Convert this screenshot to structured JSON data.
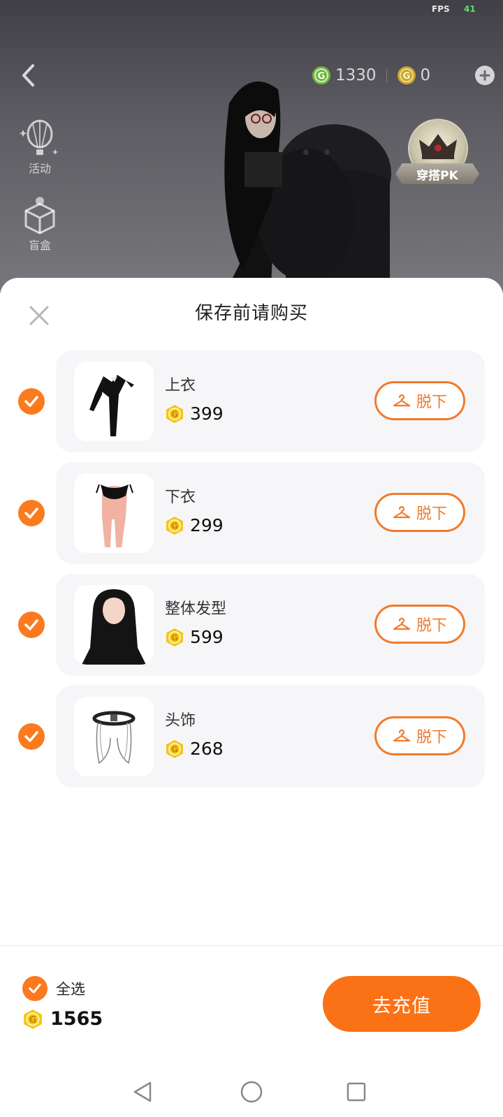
{
  "status": {
    "fps_label": "FPS",
    "fps_value": "41"
  },
  "top_bar": {
    "green_currency": "1330",
    "gold_currency": "0"
  },
  "side_menu": [
    {
      "label": "活动",
      "icon": "hot-air-balloon-icon"
    },
    {
      "label": "盲盒",
      "icon": "gift-box-icon"
    }
  ],
  "pk_badge": {
    "label": "穿搭PK"
  },
  "sheet": {
    "title": "保存前请购买",
    "items": [
      {
        "name": "上衣",
        "price": "399",
        "action": "脱下",
        "checked": true
      },
      {
        "name": "下衣",
        "price": "299",
        "action": "脱下",
        "checked": true
      },
      {
        "name": "整体发型",
        "price": "599",
        "action": "脱下",
        "checked": true
      },
      {
        "name": "头饰",
        "price": "268",
        "action": "脱下",
        "checked": true
      }
    ]
  },
  "footer": {
    "select_all_label": "全选",
    "total": "1565",
    "recharge_label": "去充值"
  },
  "colors": {
    "accent": "#fb7a1e",
    "coin_gold": "#f5c518",
    "coin_green": "#6fb63c"
  }
}
